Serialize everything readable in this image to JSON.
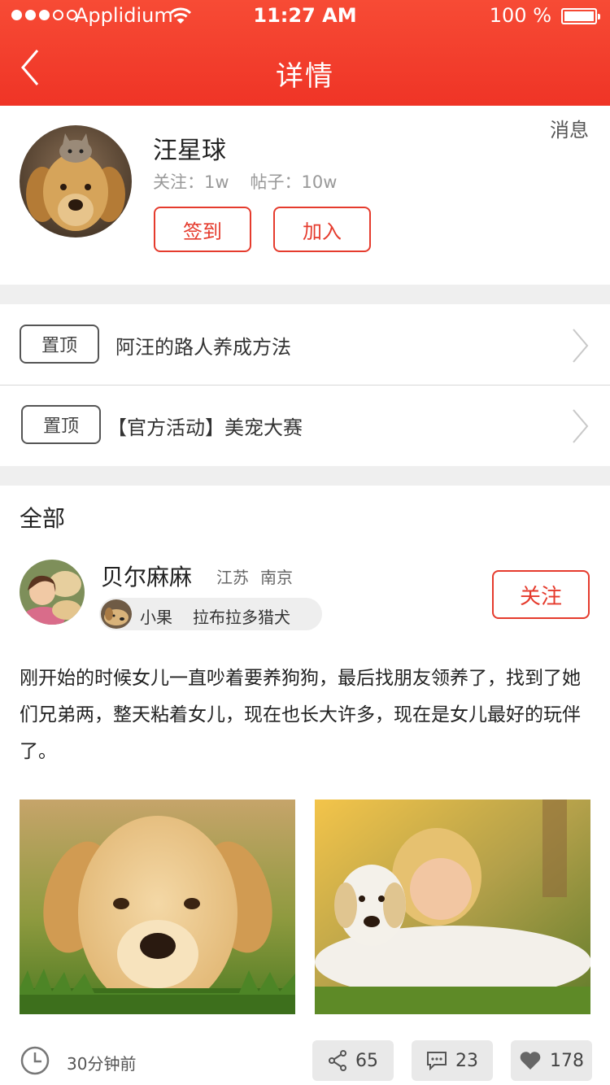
{
  "status_bar": {
    "carrier": "Applidium",
    "time": "11:27 AM",
    "battery": "100 %"
  },
  "nav": {
    "title": "详情",
    "back_icon": "chevron-left-icon"
  },
  "profile": {
    "name": "汪星球",
    "follow_label": "关注：",
    "follow_count": "1w",
    "posts_label": "帖子：",
    "posts_count": "10w",
    "checkin_button": "签到",
    "join_button": "加入",
    "message_link": "消息"
  },
  "pinned": [
    {
      "tag": "置顶",
      "title": "阿汪的路人养成方法"
    },
    {
      "tag": "置顶",
      "title": "【官方活动】美宠大赛"
    }
  ],
  "feed": {
    "section_title": "全部",
    "post": {
      "author": "贝尔麻麻",
      "province": "江苏",
      "city": "南京",
      "pet_name": "小果",
      "pet_breed": "拉布拉多猎犬",
      "follow_button": "关注",
      "text": "刚开始的时候女儿一直吵着要养狗狗，最后找朋友领养了，找到了她们兄弟两，整天粘着女儿，现在也长大许多，现在是女儿最好的玩伴了。",
      "time": "30分钟前",
      "shares": "65",
      "comments": "23",
      "likes": "178"
    }
  },
  "colors": {
    "accent": "#ef3426",
    "gray_bg": "#efefef"
  }
}
